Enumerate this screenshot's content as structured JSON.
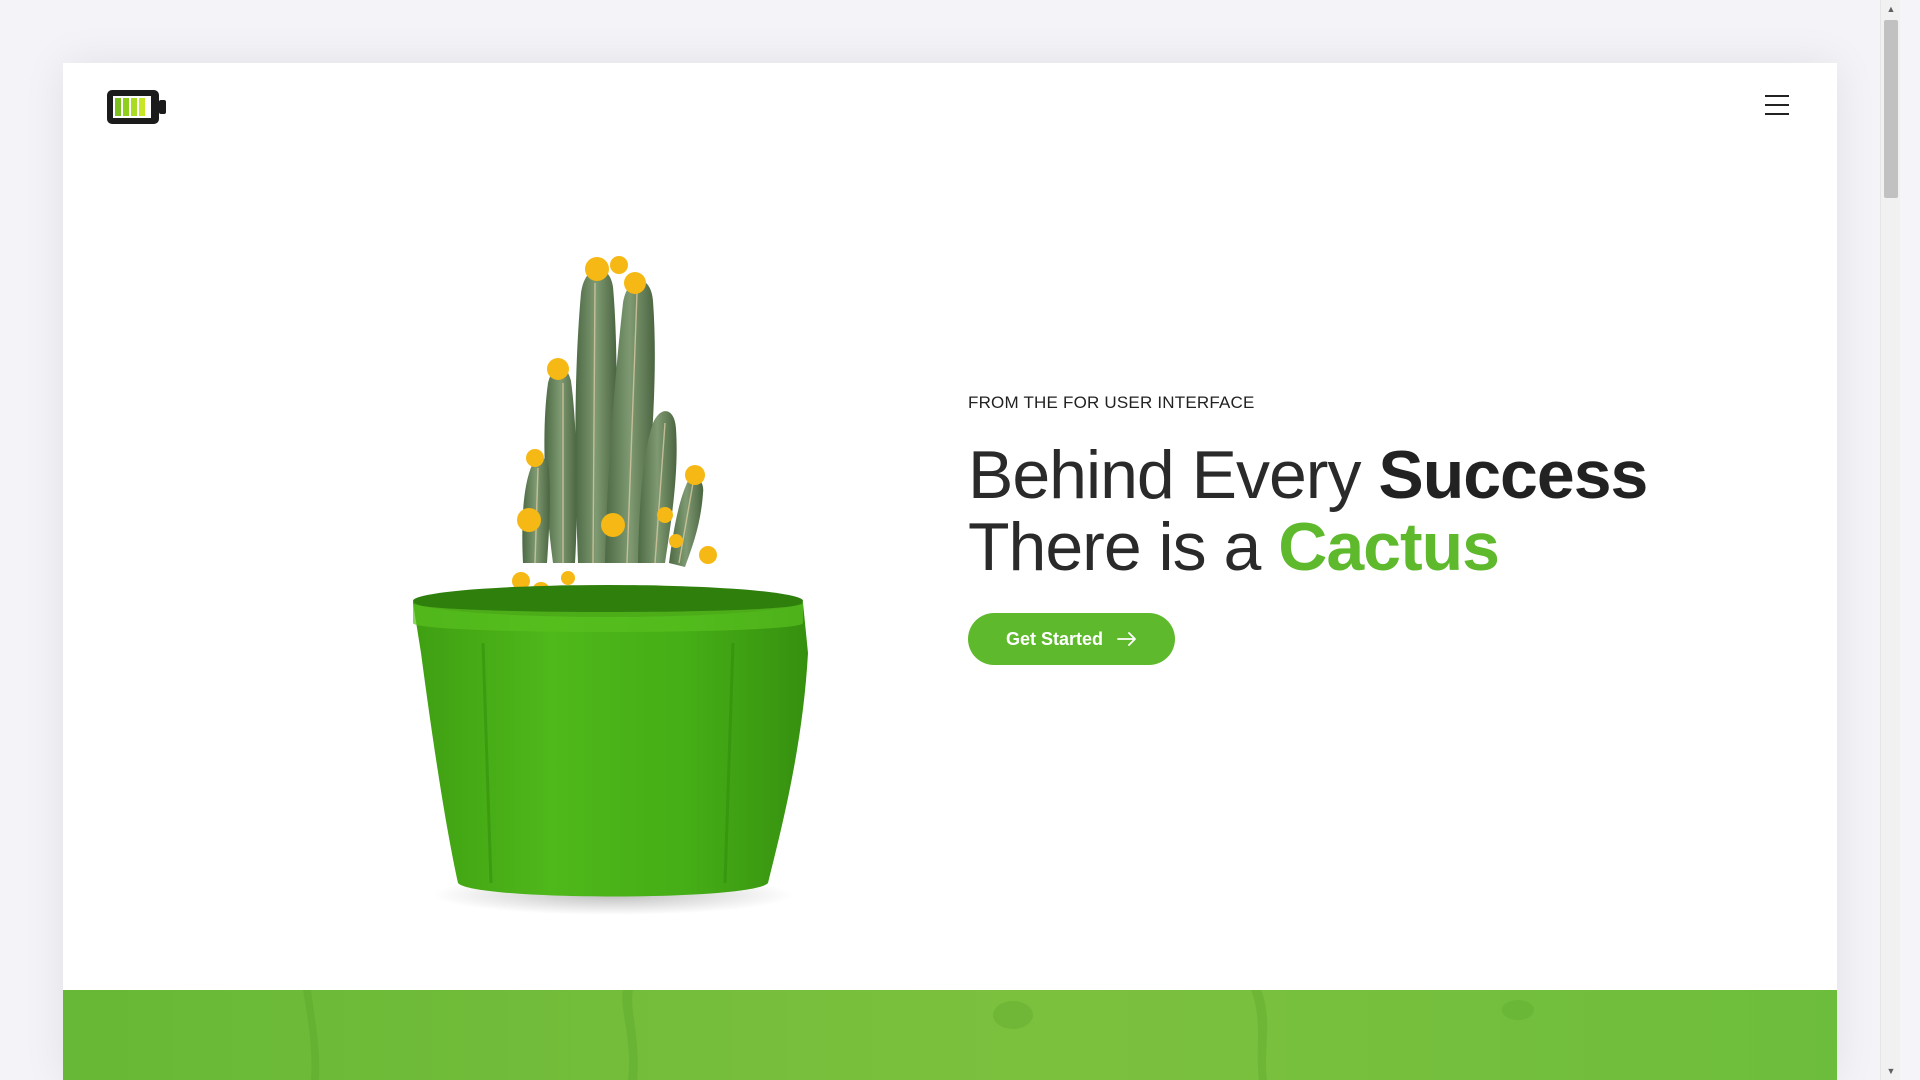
{
  "header": {
    "logo_icon": "battery-icon",
    "menu_icon": "hamburger-menu-icon"
  },
  "hero": {
    "eyebrow": "FROM THE FOR USER INTERFACE",
    "headline_line1_light": "Behind Every ",
    "headline_line1_bold": "Success",
    "headline_line2_light": "There is a ",
    "headline_line2_accent": "Cactus",
    "cta_label": "Get Started",
    "cta_icon": "arrow-right-icon",
    "image": "cactus-in-green-pot-image"
  },
  "scrollbar": {
    "up_icon": "triangle-up-icon",
    "down_icon": "triangle-down-icon"
  },
  "colors": {
    "accent": "#5fb92c",
    "text": "#222222",
    "background": "#f3f3f8",
    "card": "#ffffff"
  }
}
